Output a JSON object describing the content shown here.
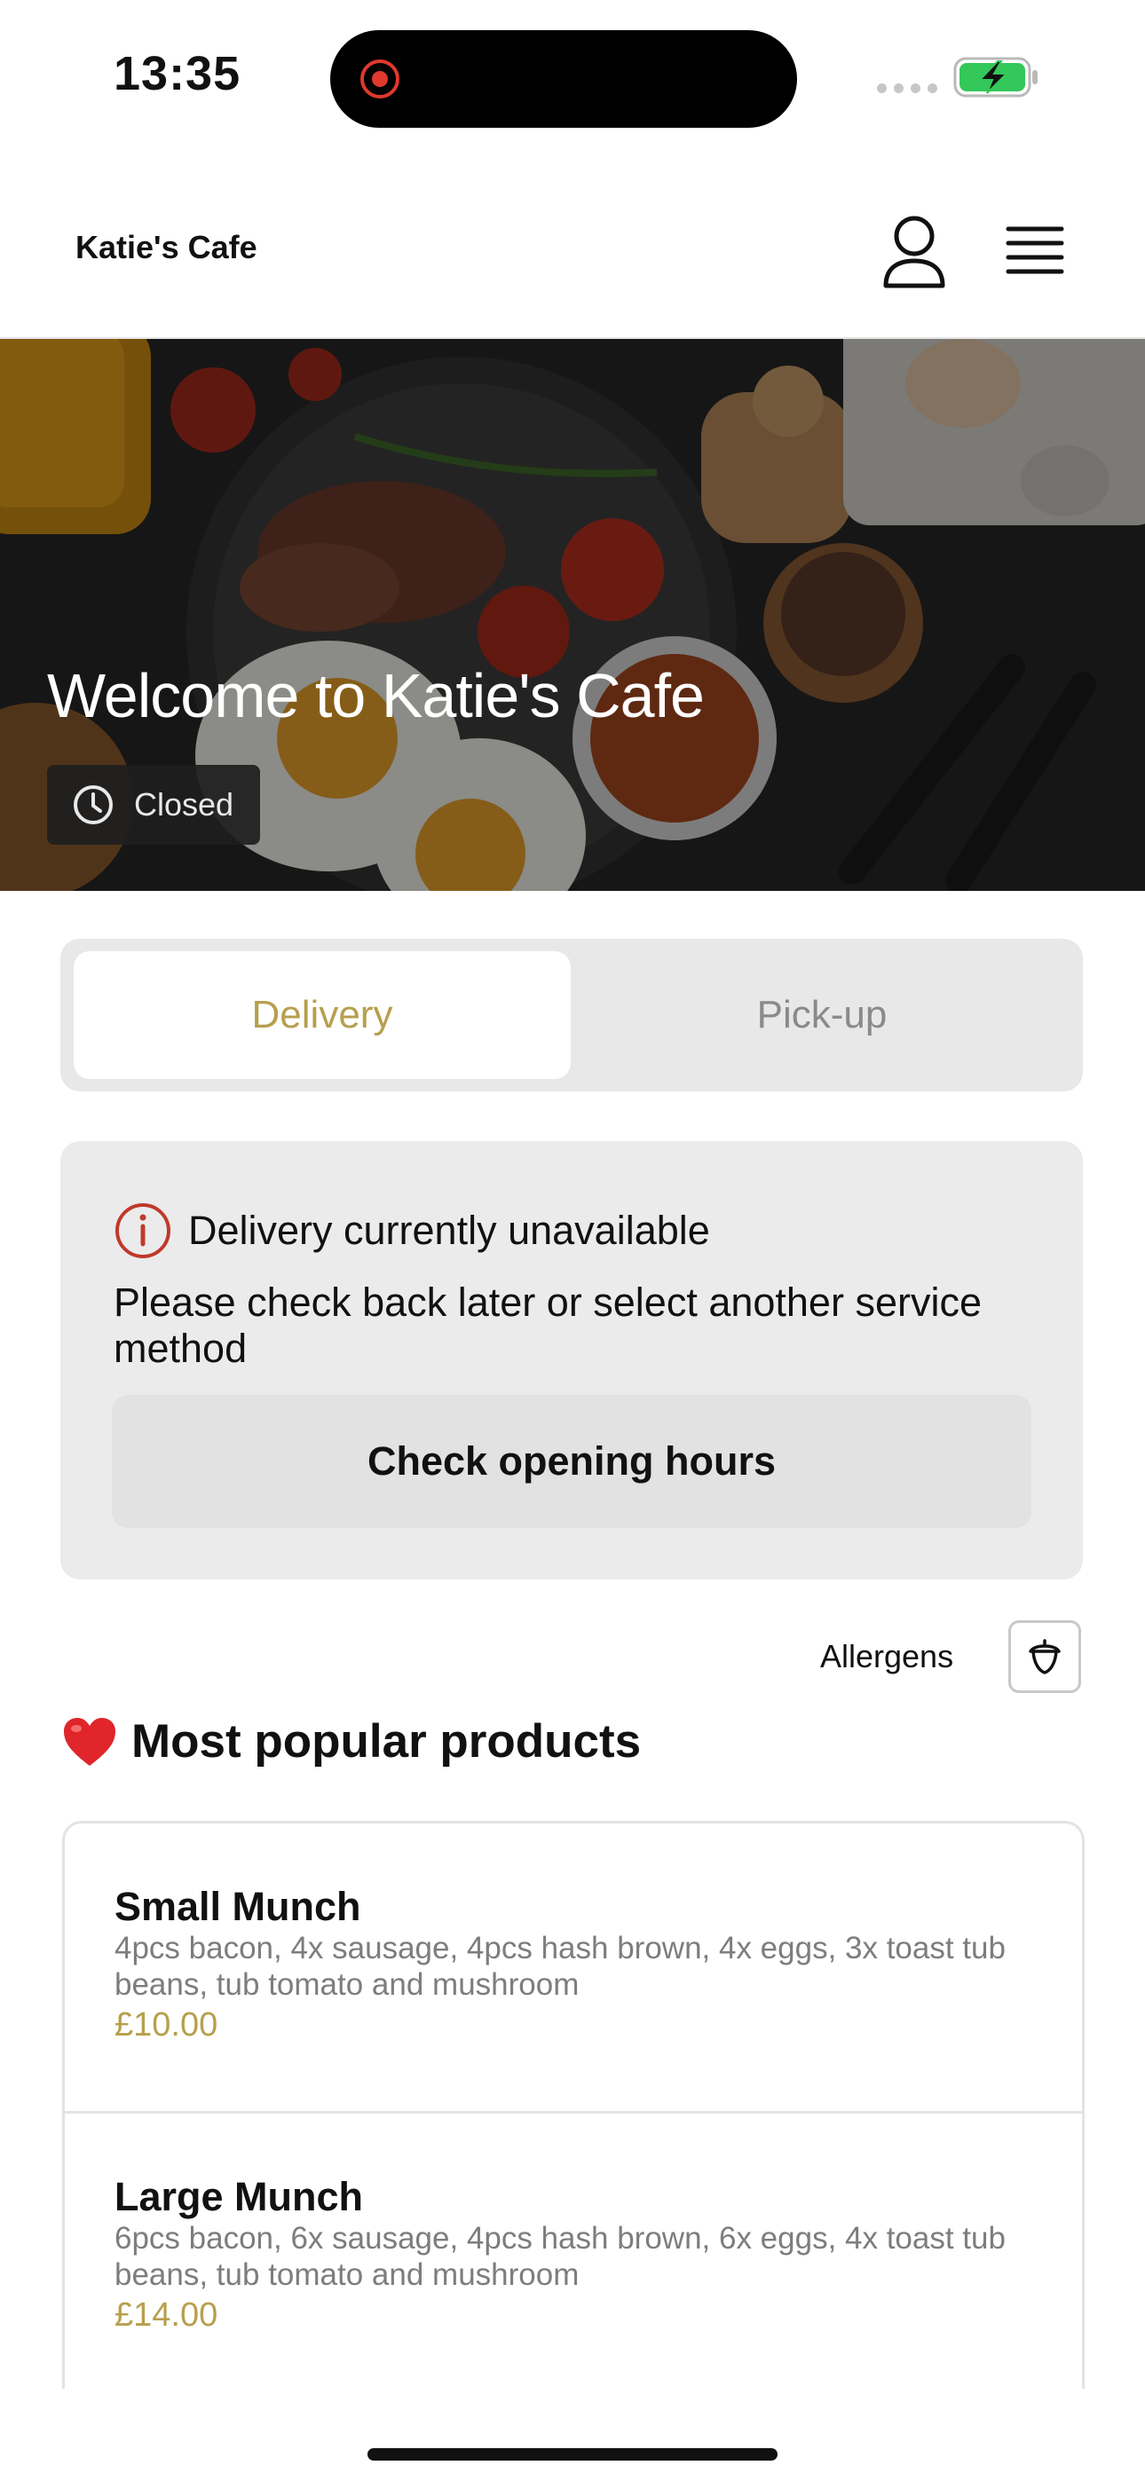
{
  "status_bar": {
    "time": "13:35"
  },
  "header": {
    "brand": "Katie's Cafe"
  },
  "hero": {
    "title": "Welcome to Katie's Cafe",
    "status": "Closed"
  },
  "service_tabs": [
    {
      "label": "Delivery",
      "selected": true
    },
    {
      "label": "Pick-up",
      "selected": false
    }
  ],
  "alert": {
    "title": "Delivery currently unavailable",
    "message": "Please check back later or select another service method",
    "button": "Check opening hours"
  },
  "allergens": {
    "label": "Allergens"
  },
  "popular": {
    "emoji": "❤️",
    "title": "Most popular products",
    "items": [
      {
        "name": "Small Munch",
        "description": "4pcs bacon, 4x sausage, 4pcs hash brown, 4x eggs, 3x toast tub beans, tub tomato and mushroom",
        "price": "£10.00"
      },
      {
        "name": "Large Munch",
        "description": "6pcs bacon, 6x sausage, 4pcs hash brown, 6x eggs, 4x toast tub beans, tub tomato and mushroom",
        "price": "£14.00"
      }
    ]
  },
  "colors": {
    "accent": "#b79f4e",
    "alert_icon": "#c0392b",
    "battery": "#34c759"
  },
  "icons": [
    "record-icon",
    "signal-icon",
    "battery-charging-icon",
    "user-icon",
    "hamburger-menu-icon",
    "clock-icon",
    "info-icon",
    "acorn-icon",
    "heart-emoji-icon"
  ]
}
